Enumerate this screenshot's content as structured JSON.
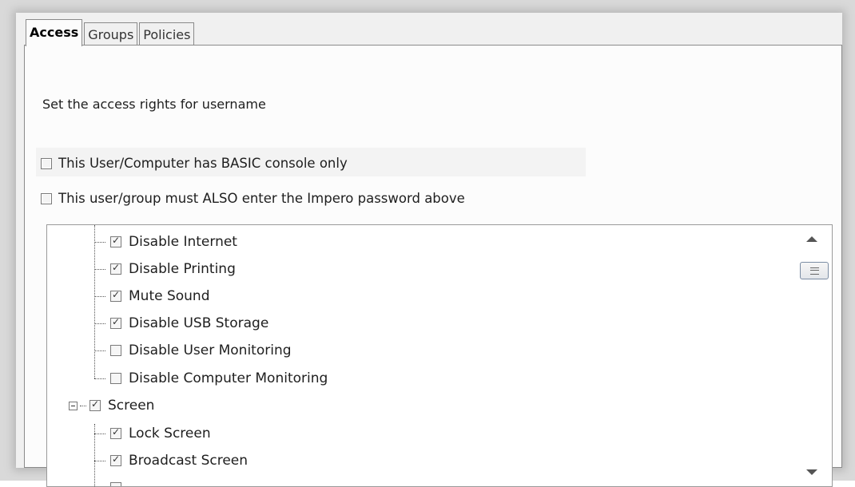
{
  "tabs": [
    {
      "label": "Access",
      "active": true
    },
    {
      "label": "Groups",
      "active": false
    },
    {
      "label": "Policies",
      "active": false
    }
  ],
  "access_text": "Set the access rights for username",
  "options": {
    "basic_console": {
      "label": "This User/Computer has BASIC console only",
      "checked": false
    },
    "impero_password": {
      "label": "This user/group must ALSO enter the Impero password above",
      "checked": false
    }
  },
  "tree": {
    "items": [
      {
        "label": "Disable Internet",
        "checked": true
      },
      {
        "label": "Disable Printing",
        "checked": true
      },
      {
        "label": "Mute Sound",
        "checked": true
      },
      {
        "label": "Disable USB Storage",
        "checked": true
      },
      {
        "label": "Disable User Monitoring",
        "checked": false
      },
      {
        "label": "Disable Computer Monitoring",
        "checked": false
      },
      {
        "label": "Screen",
        "checked": true,
        "expanded": true
      },
      {
        "label": "Lock Screen",
        "checked": true
      },
      {
        "label": "Broadcast Screen",
        "checked": true
      }
    ]
  },
  "icons": {
    "scroll_up": "triangle-up-icon",
    "scroll_down": "triangle-down-icon",
    "scroll_thumb": "grip-icon",
    "expander": "minus-box-icon"
  }
}
